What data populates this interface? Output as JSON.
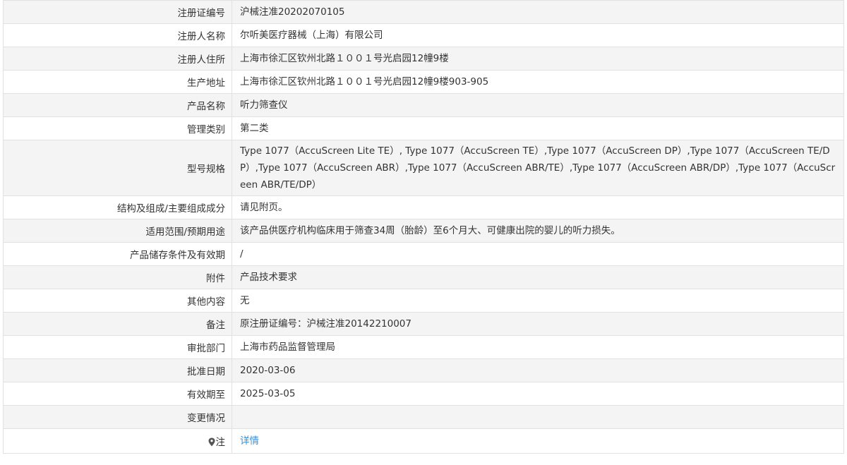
{
  "rows": [
    {
      "label": "注册证编号",
      "value": "沪械注准20202070105"
    },
    {
      "label": "注册人名称",
      "value": "尔听美医疗器械（上海）有限公司"
    },
    {
      "label": "注册人住所",
      "value": "上海市徐汇区钦州北路１００１号光启园12幢9楼"
    },
    {
      "label": "生产地址",
      "value": "上海市徐汇区钦州北路１００１号光启园12幢9楼903-905"
    },
    {
      "label": "产品名称",
      "value": "听力筛查仪"
    },
    {
      "label": "管理类别",
      "value": "第二类"
    },
    {
      "label": "型号规格",
      "value": "Type 1077（AccuScreen Lite TE）, Type 1077（AccuScreen TE）,Type 1077（AccuScreen DP）,Type 1077（AccuScreen TE/DP）,Type 1077（AccuScreen ABR）,Type 1077（AccuScreen ABR/TE）,Type 1077（AccuScreen ABR/DP）,Type 1077（AccuScreen ABR/TE/DP）"
    },
    {
      "label": "结构及组成/主要组成成分",
      "value": "请见附页。"
    },
    {
      "label": "适用范围/预期用途",
      "value": "该产品供医疗机构临床用于筛查34周（胎龄）至6个月大、可健康出院的婴儿的听力损失。"
    },
    {
      "label": "产品储存条件及有效期",
      "value": "/"
    },
    {
      "label": "附件",
      "value": "产品技术要求"
    },
    {
      "label": "其他内容",
      "value": "无"
    },
    {
      "label": "备注",
      "value": "原注册证编号：沪械注准20142210007"
    },
    {
      "label": "审批部门",
      "value": "上海市药品监督管理局"
    },
    {
      "label": "批准日期",
      "value": "2020-03-06"
    },
    {
      "label": "有效期至",
      "value": "2025-03-05"
    },
    {
      "label": "变更情况",
      "value": ""
    }
  ],
  "note": {
    "label": "注",
    "icon": "map-pin-icon",
    "link": "详情",
    "link_color": "#3c8dd0"
  },
  "colors": {
    "row_alt": "#f4f4f4",
    "row": "#ffffff",
    "border": "#e1e1e1",
    "text": "#333333"
  }
}
